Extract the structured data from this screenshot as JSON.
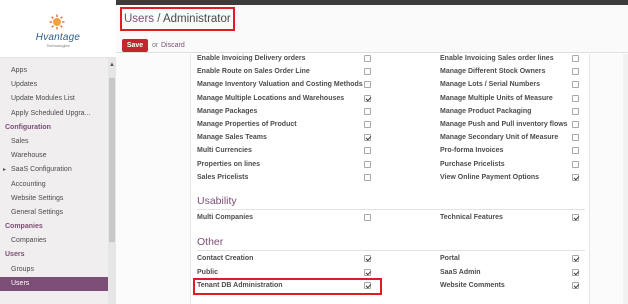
{
  "logo": {
    "name": "Hvantage",
    "sub": "Technologies"
  },
  "nav": [
    {
      "type": "item",
      "label": "Apps"
    },
    {
      "type": "item",
      "label": "Updates"
    },
    {
      "type": "item",
      "label": "Update Modules List"
    },
    {
      "type": "item",
      "label": "Apply Scheduled Upgra..."
    },
    {
      "type": "section",
      "label": "Configuration"
    },
    {
      "type": "item",
      "label": "Sales"
    },
    {
      "type": "item",
      "label": "Warehouse"
    },
    {
      "type": "item",
      "label": "SaaS Configuration",
      "expandable": true
    },
    {
      "type": "item",
      "label": "Accounting"
    },
    {
      "type": "item",
      "label": "Website Settings"
    },
    {
      "type": "item",
      "label": "General Settings"
    },
    {
      "type": "section",
      "label": "Companies"
    },
    {
      "type": "item",
      "label": "Companies"
    },
    {
      "type": "section",
      "label": "Users"
    },
    {
      "type": "item",
      "label": "Groups"
    },
    {
      "type": "item",
      "label": "Users",
      "active": true
    }
  ],
  "breadcrumb": {
    "parent": "Users",
    "separator": " / ",
    "current": "Administrator"
  },
  "actions": {
    "save": "Save",
    "or": "or",
    "discard": "Discard"
  },
  "rights": [
    {
      "left": "Enable Invoicing Delivery orders",
      "left_checked": false,
      "right": "Enable Invoicing Sales order lines",
      "right_checked": false
    },
    {
      "left": "Enable Route on Sales Order Line",
      "left_checked": false,
      "right": "Manage Different Stock Owners",
      "right_checked": false
    },
    {
      "left": "Manage Inventory Valuation and Costing Methods",
      "left_checked": false,
      "right": "Manage Lots / Serial Numbers",
      "right_checked": false
    },
    {
      "left": "Manage Multiple Locations and Warehouses",
      "left_checked": true,
      "right": "Manage Multiple Units of Measure",
      "right_checked": false
    },
    {
      "left": "Manage Packages",
      "left_checked": false,
      "right": "Manage Product Packaging",
      "right_checked": false
    },
    {
      "left": "Manage Properties of Product",
      "left_checked": false,
      "right": "Manage Push and Pull inventory flows",
      "right_checked": false
    },
    {
      "left": "Manage Sales Teams",
      "left_checked": true,
      "right": "Manage Secondary Unit of Measure",
      "right_checked": false
    },
    {
      "left": "Multi Currencies",
      "left_checked": false,
      "right": "Pro-forma Invoices",
      "right_checked": false
    },
    {
      "left": "Properties on lines",
      "left_checked": false,
      "right": "Purchase Pricelists",
      "right_checked": false
    },
    {
      "left": "Sales Pricelists",
      "left_checked": false,
      "right": "View Online Payment Options",
      "right_checked": true
    }
  ],
  "usability": {
    "title": "Usability",
    "rows": [
      {
        "left": "Multi Companies",
        "left_checked": false,
        "right": "Technical Features",
        "right_checked": true
      }
    ]
  },
  "other": {
    "title": "Other",
    "rows": [
      {
        "left": "Contact Creation",
        "left_checked": true,
        "right": "Portal",
        "right_checked": true
      },
      {
        "left": "Public",
        "left_checked": true,
        "right": "SaaS Admin",
        "right_checked": true
      },
      {
        "left": "Tenant DB Administration",
        "left_checked": true,
        "right": "Website Comments",
        "right_checked": true
      }
    ]
  },
  "colors": {
    "brand": "#7c4d75",
    "save": "#c1272d",
    "highlight": "#e01b24"
  }
}
